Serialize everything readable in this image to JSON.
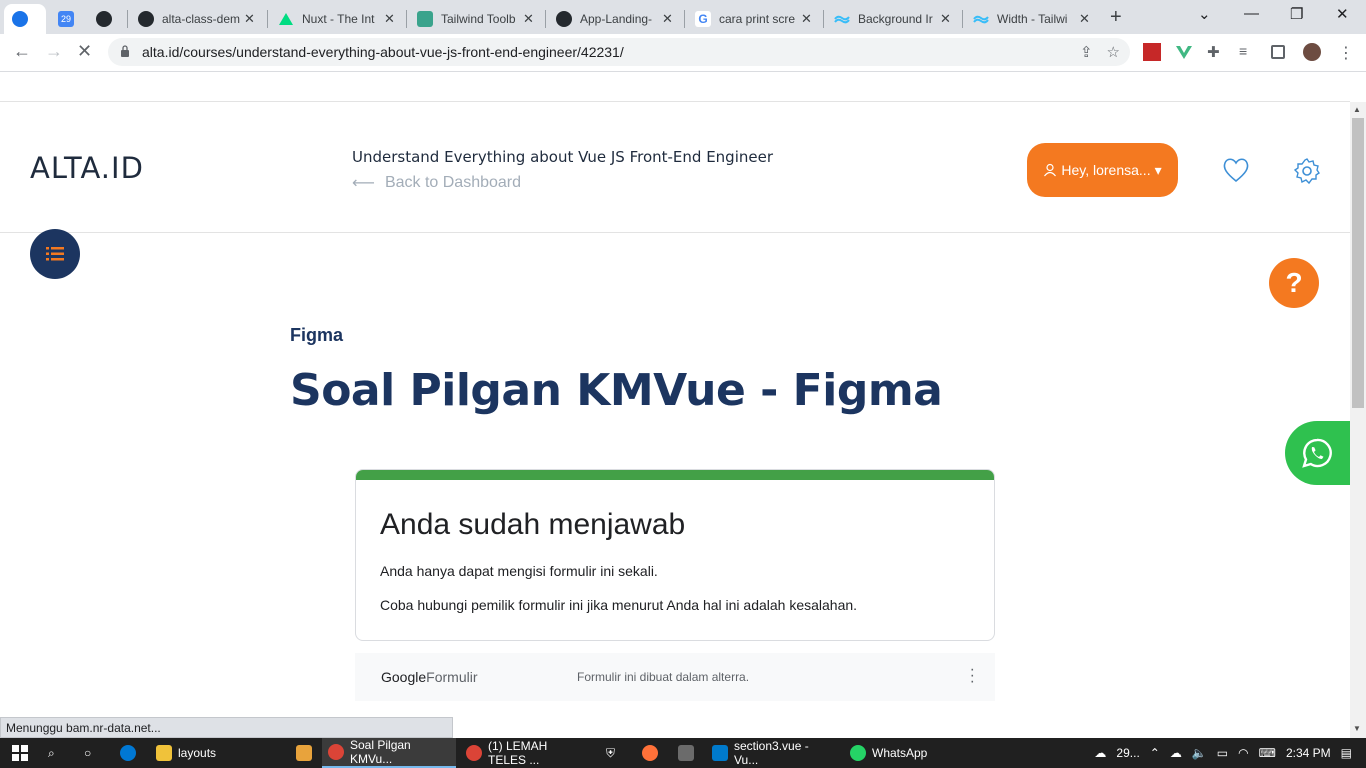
{
  "browser": {
    "tabs": [
      {
        "label": "",
        "icon": "app-icon",
        "active": true
      },
      {
        "label": "",
        "icon": "calendar-icon"
      },
      {
        "label": "",
        "icon": "github-icon"
      },
      {
        "label": "alta-class-dem",
        "icon": "github-icon"
      },
      {
        "label": "Nuxt - The Int",
        "icon": "nuxt-icon"
      },
      {
        "label": "Tailwind Toolb",
        "icon": "tailwind-toolbox-icon"
      },
      {
        "label": "App-Landing-",
        "icon": "github-icon"
      },
      {
        "label": "cara print scre",
        "icon": "google-icon"
      },
      {
        "label": "Background Ir",
        "icon": "tailwind-icon"
      },
      {
        "label": "Width - Tailwi",
        "icon": "tailwind-icon"
      }
    ],
    "url": "alta.id/courses/understand-everything-about-vue-js-front-end-engineer/42231/",
    "status_text": "Menunggu bam.nr-data.net..."
  },
  "header": {
    "logo": "ALTA.ID",
    "course_title": "Understand Everything about Vue JS Front-End Engineer",
    "back_link": "Back to Dashboard",
    "user_button": "Hey, lorensa..."
  },
  "lesson": {
    "category": "Figma",
    "title": "Soal Pilgan KMVue - Figma"
  },
  "form": {
    "heading": "Anda sudah menjawab",
    "line1": "Anda hanya dapat mengisi formulir ini sekali.",
    "line2": "Coba hubungi pemilik formulir ini jika menurut Anda hal ini adalah kesalahan.",
    "footer_brand_google": "Google",
    "footer_brand_product": "Formulir",
    "footer_note": "Formulir ini dibuat dalam alterra."
  },
  "taskbar": {
    "items": [
      {
        "label": "layouts"
      },
      {
        "label": "Soal Pilgan KMVu..."
      },
      {
        "label": "(1) LEMAH TELES ..."
      },
      {
        "label": "section3.vue - Vu..."
      },
      {
        "label": "WhatsApp"
      }
    ],
    "weather": "29...",
    "time": "2:34 PM"
  },
  "colors": {
    "brand_navy": "#1c3560",
    "accent_orange": "#f47920",
    "form_green": "#43a047",
    "whatsapp_green": "#2fc14f"
  }
}
